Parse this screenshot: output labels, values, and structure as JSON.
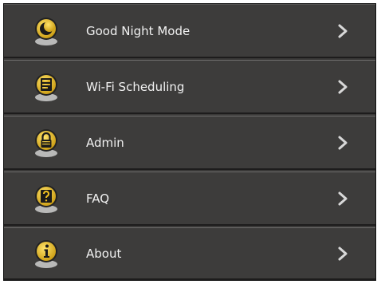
{
  "menu": {
    "items": [
      {
        "label": "Good Night Mode",
        "icon": "moon-icon"
      },
      {
        "label": "Wi-Fi Scheduling",
        "icon": "wifi-schedule-icon"
      },
      {
        "label": "Admin",
        "icon": "lock-icon"
      },
      {
        "label": "FAQ",
        "icon": "question-icon"
      },
      {
        "label": "About",
        "icon": "info-icon"
      }
    ]
  },
  "colors": {
    "background": "#3d3c3b",
    "icon_gold": "#f0c020",
    "text": "#f2f2f2"
  }
}
